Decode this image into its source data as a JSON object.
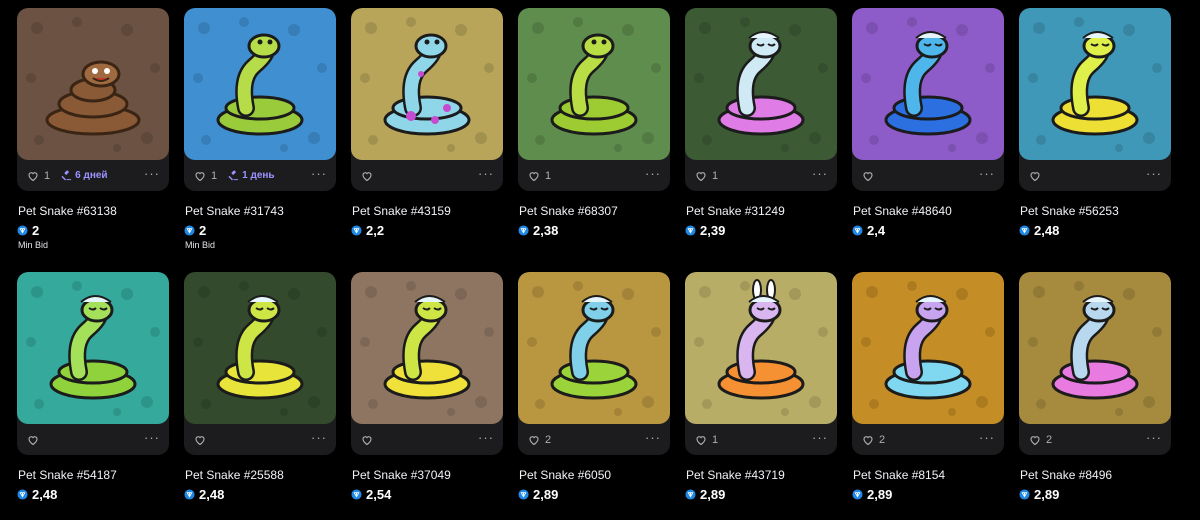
{
  "brand": {
    "accent": "#9b93ff",
    "ton_color": "#1e88e5",
    "card_bg": "#1c1c1e"
  },
  "items": [
    {
      "name": "Pet Snake #63138",
      "likes": "1",
      "auction": "6 дней",
      "price": "2",
      "price_note": "Min Bid",
      "bg": "#6b5242",
      "body": "#8a5a36",
      "head": "#8a5a36",
      "icon": "poop-snake-icon"
    },
    {
      "name": "Pet Snake #31743",
      "likes": "1",
      "auction": "1 день",
      "price": "2",
      "price_note": "Min Bid",
      "bg": "#3f8fd1",
      "body": "#9acb3a",
      "head": "#b6dc4a",
      "icon": "green-snake-icon"
    },
    {
      "name": "Pet Snake #43159",
      "likes": "",
      "auction": "",
      "price": "2,2",
      "price_note": "",
      "bg": "#b8a55a",
      "body": "#8fd6e8",
      "head": "#8fd6e8",
      "icon": "blue-spotted-snake-icon"
    },
    {
      "name": "Pet Snake #68307",
      "likes": "1",
      "auction": "",
      "price": "2,38",
      "price_note": "",
      "bg": "#5e8d4e",
      "body": "#9ccb32",
      "head": "#b9de45",
      "icon": "green-snake-icon"
    },
    {
      "name": "Pet Snake #31249",
      "likes": "1",
      "auction": "",
      "price": "2,39",
      "price_note": "",
      "bg": "#3c5a34",
      "body": "#e07ce6",
      "head": "#cfe9f5",
      "icon": "pink-sleepy-snake-icon"
    },
    {
      "name": "Pet Snake #48640",
      "likes": "",
      "auction": "",
      "price": "2,4",
      "price_note": "",
      "bg": "#8e5cc9",
      "body": "#2b6fe0",
      "head": "#4fb6ec",
      "icon": "blue-sleepy-snake-icon"
    },
    {
      "name": "Pet Snake #56253",
      "likes": "",
      "auction": "",
      "price": "2,48",
      "price_note": "",
      "bg": "#3f98b8",
      "body": "#eedf34",
      "head": "#dff04a",
      "icon": "yellow-sleepy-snake-icon"
    },
    {
      "name": "Pet Snake #54187",
      "likes": "",
      "auction": "",
      "price": "2,48",
      "price_note": "",
      "bg": "#34a99c",
      "body": "#8fd23b",
      "head": "#a4e05a",
      "icon": "green-sleepy-snake-icon"
    },
    {
      "name": "Pet Snake #25588",
      "likes": "",
      "auction": "",
      "price": "2,48",
      "price_note": "",
      "bg": "#334a2c",
      "body": "#e8e43a",
      "head": "#cde645",
      "icon": "yellow-sleepy-snake-icon"
    },
    {
      "name": "Pet Snake #37049",
      "likes": "",
      "auction": "",
      "price": "2,54",
      "price_note": "",
      "bg": "#8e7562",
      "body": "#f0e03a",
      "head": "#cde645",
      "icon": "yellow-sleepy-snake-icon"
    },
    {
      "name": "Pet Snake #6050",
      "likes": "2",
      "auction": "",
      "price": "2,89",
      "price_note": "",
      "bg": "#b99640",
      "body": "#9bd33a",
      "head": "#7fd0e8",
      "icon": "green-sleepy-snake-icon"
    },
    {
      "name": "Pet Snake #43719",
      "likes": "1",
      "auction": "",
      "price": "2,89",
      "price_note": "",
      "bg": "#b8ad66",
      "body": "#f59033",
      "head": "#d9b6f0",
      "icon": "bunny-snake-icon"
    },
    {
      "name": "Pet Snake #8154",
      "likes": "2",
      "auction": "",
      "price": "2,89",
      "price_note": "",
      "bg": "#c48d25",
      "body": "#7fd8f0",
      "head": "#c8a4f0",
      "icon": "frost-sleepy-snake-icon"
    },
    {
      "name": "Pet Snake #8496",
      "likes": "2",
      "auction": "",
      "price": "2,89",
      "price_note": "",
      "bg": "#a68a3e",
      "body": "#e87ae0",
      "head": "#b8d8f0",
      "icon": "pink-sleepy-snake-icon"
    }
  ]
}
